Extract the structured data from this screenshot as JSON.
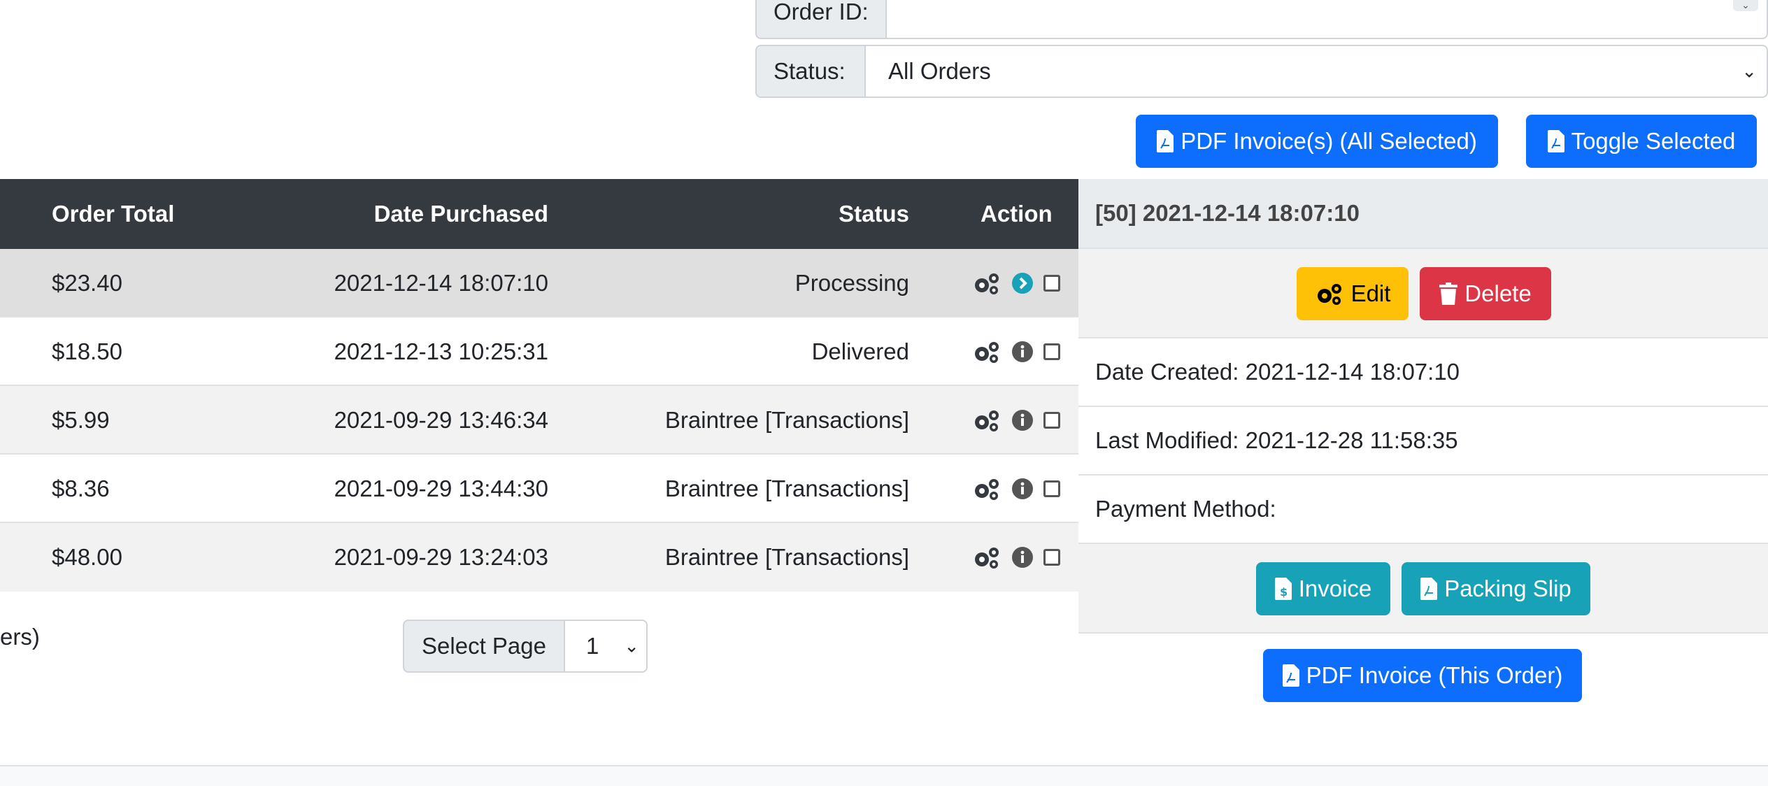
{
  "filters": {
    "order_id_label": "Order ID:",
    "order_id_value": "",
    "status_label": "Status:",
    "status_value": "All Orders"
  },
  "toolbar": {
    "pdf_invoices_label": "PDF Invoice(s) (All Selected)",
    "toggle_selected_label": "Toggle Selected"
  },
  "table": {
    "headers": {
      "order_total": "Order Total",
      "date_purchased": "Date Purchased",
      "status": "Status",
      "action": "Action"
    },
    "rows": [
      {
        "total": "$23.40",
        "date": "2021-12-14 18:07:10",
        "status": "Processing",
        "selected": true
      },
      {
        "total": "$18.50",
        "date": "2021-12-13 10:25:31",
        "status": "Delivered",
        "selected": false
      },
      {
        "total": "$5.99",
        "date": "2021-09-29 13:46:34",
        "status": "Braintree [Transactions]",
        "selected": false
      },
      {
        "total": "$8.36",
        "date": "2021-09-29 13:44:30",
        "status": "Braintree [Transactions]",
        "selected": false
      },
      {
        "total": "$48.00",
        "date": "2021-09-29 13:24:03",
        "status": "Braintree [Transactions]",
        "selected": false
      }
    ]
  },
  "footer": {
    "partial_text": "ers)",
    "select_page_label": "Select Page",
    "page_value": "1"
  },
  "panel": {
    "title": "[50] 2021-12-14 18:07:10",
    "edit_label": "Edit",
    "delete_label": "Delete",
    "date_created": "Date Created: 2021-12-14 18:07:10",
    "last_modified": "Last Modified: 2021-12-28 11:58:35",
    "payment_method": "Payment Method:",
    "invoice_label": "Invoice",
    "packing_slip_label": "Packing Slip",
    "pdf_invoice_label": "PDF Invoice (This Order)"
  },
  "colors": {
    "primary": "#0d6efd",
    "warning": "#ffc107",
    "danger": "#dc3545",
    "info": "#17a2b8",
    "table_header": "#343a40"
  }
}
